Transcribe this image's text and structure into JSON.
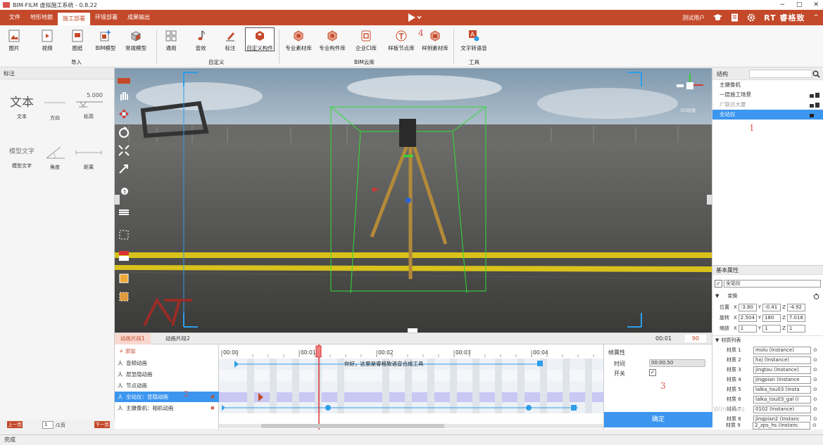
{
  "window": {
    "title": "BIM-FILM 虚拟施工系统 - 0.8.22",
    "controls": [
      "−",
      "□",
      "✕"
    ]
  },
  "menubar": {
    "items": [
      "文件",
      "地形地貌",
      "施工部署",
      "环境部署",
      "成果输出"
    ],
    "active_index": 2,
    "user": "测试用户",
    "brand": "RT 睿格致",
    "brand_caret": "^"
  },
  "ribbon": {
    "buttons": [
      "图片",
      "视频",
      "图纸",
      "BIM模型",
      "常规模型",
      "通用",
      "音效",
      "标注",
      "自定义构件",
      "专业素材库",
      "专业构件库",
      "企业CI库",
      "样板节点库",
      "样例素材库",
      "文字转语音"
    ],
    "groups": [
      "导入",
      "自定义",
      "BIM云库",
      "工具"
    ]
  },
  "annotations": {
    "n1": "1",
    "n2": "2",
    "n3": "3",
    "n4": "4"
  },
  "left_panel": {
    "title": "标注",
    "big_text": "文本",
    "model_text": "模型文字",
    "dim_value": "5.000",
    "tools": [
      "文本",
      "方向",
      "标高",
      "模型文字",
      "角度",
      "距离"
    ]
  },
  "viewport": {
    "view_label": "3D视角",
    "colors": {
      "sky": "#9fb3c4",
      "ground": "#4a4a48",
      "stripe": "#d9c21b",
      "box": "#33dd33",
      "frame": "#2d9ee8"
    }
  },
  "right_panel": {
    "structure_title": "结构",
    "tree": [
      "主摄像机",
      "一层施工场景",
      "广联达大厦",
      "全站仪"
    ],
    "selected_index": 3,
    "basic_props_title": "基本属性",
    "object_name": "全站仪",
    "transform_label": "变换",
    "position": {
      "label": "位置",
      "x": "-3.80",
      "y": "-0.41",
      "z": "-4.92"
    },
    "rotation": {
      "label": "旋转",
      "x": "2.504",
      "y": "180",
      "z": "7.016"
    },
    "scale": {
      "label": "缩放",
      "x": "1",
      "y": "1",
      "z": "1"
    },
    "materials_title": "材质列表",
    "materials": [
      {
        "label": "材质 1",
        "value": "molu (Instance)"
      },
      {
        "label": "材质 2",
        "value": "hxj (Instance)"
      },
      {
        "label": "材质 3",
        "value": "jingtou (Instance)"
      },
      {
        "label": "材质 4",
        "value": "jingpian (Instance"
      },
      {
        "label": "材质 5",
        "value": "lalka_tou03 (Insta"
      },
      {
        "label": "材质 6",
        "value": "lalka_tou03_gal (I"
      },
      {
        "label": "材质 7",
        "value": "0102 (Instance)"
      },
      {
        "label": "材质 8",
        "value": "jingpian2 (Instanc"
      },
      {
        "label": "材质 9",
        "value": "2_zps_hs (Instanc"
      }
    ],
    "watermark": "激活 Windows"
  },
  "timeline": {
    "tabs": [
      "动画片段1",
      "动画片段2"
    ],
    "current_time": "00:01",
    "end_value": "90",
    "add_label": "+ 添加",
    "rows": [
      "音频动画",
      "层显隐动画",
      "节点动画",
      "全站仪：显隐动画",
      "主摄像机：相机动画"
    ],
    "selected_row": 3,
    "ruler": [
      "00:00",
      "00:01",
      "00:02",
      "00:03",
      "00:04"
    ],
    "audio_clip_text": "你好，这里是睿格致语音合成工具",
    "frame_props": {
      "title": "帧属性",
      "time_label": "时间",
      "time_value": "00:00.50",
      "switch_label": "开关",
      "confirm": "确定"
    }
  },
  "pager": {
    "prev": "上一页",
    "next": "下一页",
    "page": "1",
    "total": "/1页"
  },
  "status": "完成"
}
